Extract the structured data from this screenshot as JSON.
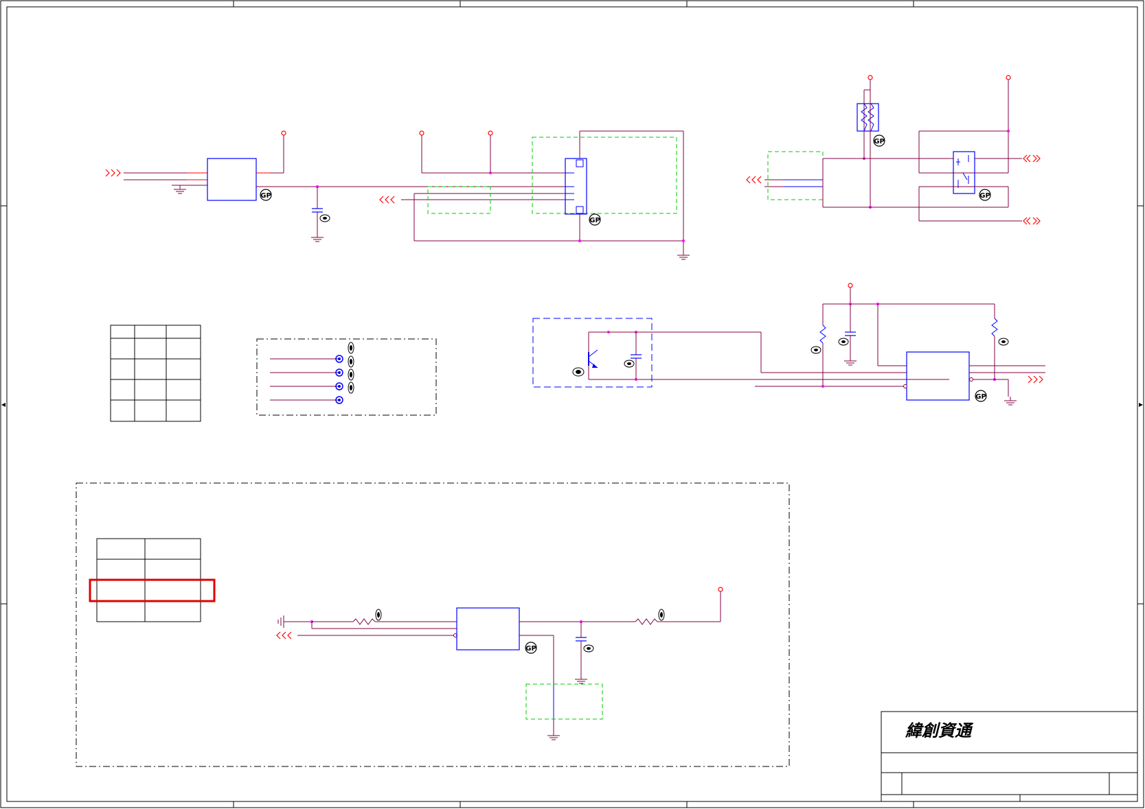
{
  "title_block": {
    "company": "緯創資通"
  },
  "badges": {
    "gp": "GP"
  },
  "colors": {
    "wire": "#800040",
    "wire_red": "#ff0000",
    "symbol": "#0000ff",
    "junction": "#ff00ff",
    "no_stuff_box": "#00cc00",
    "border": "#000000",
    "highlight": "#e00000"
  },
  "icons": {
    "ground": "ground-icon",
    "power_pin": "power-pin-icon",
    "offpage_connector": "offpage-connector-icon",
    "gp_badge": "gp-badge-icon",
    "test_point": "test-point-icon"
  }
}
